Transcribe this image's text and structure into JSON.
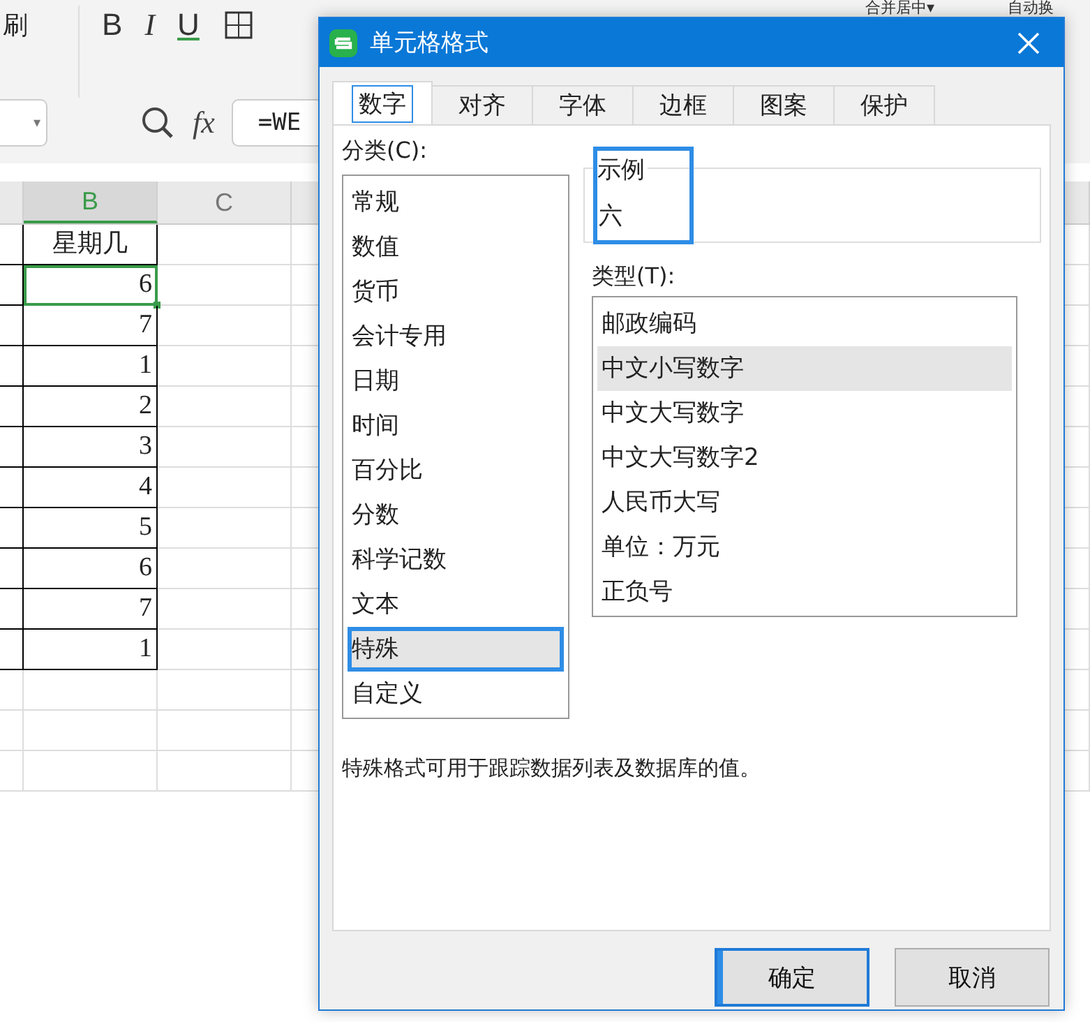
{
  "ribbon": {
    "cut_label": "刷",
    "format_buttons": [
      "B",
      "I",
      "U"
    ],
    "right_labels": [
      "合并居中",
      "自动换"
    ],
    "dropdown_glyph": "▾"
  },
  "formula_bar": {
    "formula": "=WE",
    "fx": "fx",
    "dropdown_glyph": "▾"
  },
  "sheet": {
    "columns": [
      {
        "label": "B",
        "selected": true
      },
      {
        "label": "C",
        "selected": false
      }
    ],
    "rows": [
      {
        "value": "星期几",
        "kind": "header",
        "selected": false
      },
      {
        "value": "6",
        "kind": "number",
        "selected": true
      },
      {
        "value": "7",
        "kind": "number",
        "selected": false
      },
      {
        "value": "1",
        "kind": "number",
        "selected": false
      },
      {
        "value": "2",
        "kind": "number",
        "selected": false
      },
      {
        "value": "3",
        "kind": "number",
        "selected": false
      },
      {
        "value": "4",
        "kind": "number",
        "selected": false
      },
      {
        "value": "5",
        "kind": "number",
        "selected": false
      },
      {
        "value": "6",
        "kind": "number",
        "selected": false
      },
      {
        "value": "7",
        "kind": "number",
        "selected": false
      },
      {
        "value": "1",
        "kind": "number",
        "selected": false
      }
    ]
  },
  "dialog": {
    "title": "单元格格式",
    "tabs": [
      {
        "label": "数字",
        "selected": true,
        "highlighted": true
      },
      {
        "label": "对齐",
        "selected": false,
        "highlighted": false
      },
      {
        "label": "字体",
        "selected": false,
        "highlighted": false
      },
      {
        "label": "边框",
        "selected": false,
        "highlighted": false
      },
      {
        "label": "图案",
        "selected": false,
        "highlighted": false
      },
      {
        "label": "保护",
        "selected": false,
        "highlighted": false
      }
    ],
    "category_label": "分类(C):",
    "categories": [
      {
        "label": "常规",
        "selected": false,
        "highlighted": false
      },
      {
        "label": "数值",
        "selected": false,
        "highlighted": false
      },
      {
        "label": "货币",
        "selected": false,
        "highlighted": false
      },
      {
        "label": "会计专用",
        "selected": false,
        "highlighted": false
      },
      {
        "label": "日期",
        "selected": false,
        "highlighted": false
      },
      {
        "label": "时间",
        "selected": false,
        "highlighted": false
      },
      {
        "label": "百分比",
        "selected": false,
        "highlighted": false
      },
      {
        "label": "分数",
        "selected": false,
        "highlighted": false
      },
      {
        "label": "科学记数",
        "selected": false,
        "highlighted": false
      },
      {
        "label": "文本",
        "selected": false,
        "highlighted": false
      },
      {
        "label": "特殊",
        "selected": true,
        "highlighted": true
      },
      {
        "label": "自定义",
        "selected": false,
        "highlighted": false
      }
    ],
    "sample": {
      "label": "示例",
      "value": "六",
      "highlighted": true
    },
    "type_label": "类型(T):",
    "types": [
      {
        "label": "邮政编码",
        "selected": false
      },
      {
        "label": "中文小写数字",
        "selected": true
      },
      {
        "label": "中文大写数字",
        "selected": false
      },
      {
        "label": "中文大写数字2",
        "selected": false
      },
      {
        "label": "人民币大写",
        "selected": false
      },
      {
        "label": "单位：万元",
        "selected": false
      },
      {
        "label": "正负号",
        "selected": false
      }
    ],
    "description": "特殊格式可用于跟踪数据列表及数据库的值。",
    "buttons": [
      {
        "label": "确定",
        "kind": "primary",
        "highlighted": true
      },
      {
        "label": "取消",
        "kind": "secondary",
        "highlighted": false
      }
    ]
  }
}
